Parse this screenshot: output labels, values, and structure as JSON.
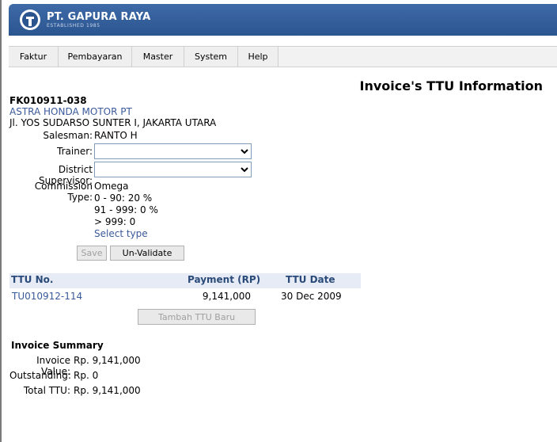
{
  "brand": {
    "name": "PT. GAPURA RAYA",
    "sub": "ESTABLISHED 1985"
  },
  "menu": [
    "Faktur",
    "Pembayaran",
    "Master",
    "System",
    "Help"
  ],
  "page_title": "Invoice's TTU Information",
  "invoice": {
    "number": "FK010911-038",
    "customer": "ASTRA HONDA MOTOR PT",
    "address": "Jl. YOS SUDARSO SUNTER I, JAKARTA UTARA",
    "salesman_label": "Salesman:",
    "salesman": "RANTO H",
    "trainer_label": "Trainer:",
    "trainer_value": "",
    "district_label": "District Supervisor:",
    "district_value": "",
    "commission_label": "Commission Type:",
    "commission_type": "Omega",
    "commission_rules": [
      "0 - 90: 20 %",
      "91 - 999: 0 %",
      "> 999: 0"
    ],
    "select_type_link": "Select type"
  },
  "buttons": {
    "save": "Save",
    "unvalidate": "Un-Validate",
    "add_ttu": "Tambah TTU Baru"
  },
  "ttu_table": {
    "headers": [
      "TTU No.",
      "Payment (RP)",
      "TTU Date"
    ],
    "rows": [
      {
        "no": "TU010912-114",
        "payment": "9,141,000",
        "date": "30 Dec 2009"
      }
    ]
  },
  "summary": {
    "title": "Invoice Summary",
    "invoice_value_label": "Invoice Value:",
    "invoice_value": "Rp. 9,141,000",
    "outstanding_label": "Outstanding:",
    "outstanding": "Rp. 0",
    "total_ttu_label": "Total TTU:",
    "total_ttu": "Rp. 9,141,000"
  }
}
